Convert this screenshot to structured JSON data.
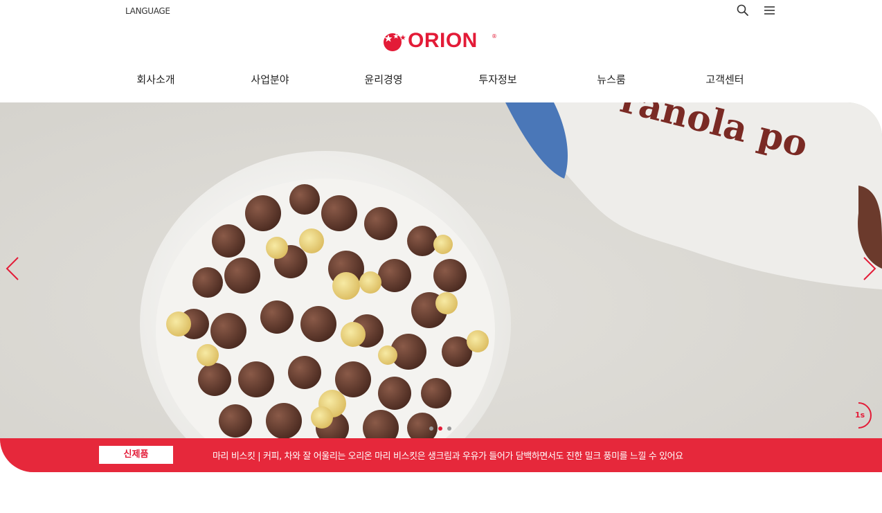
{
  "header": {
    "language_label": "LANGUAGE",
    "search_icon": "search-icon",
    "menu_icon": "hamburger-menu-icon",
    "logo_text": "ORION",
    "logo_registered": "®"
  },
  "nav": {
    "items": [
      {
        "label": "회사소개"
      },
      {
        "label": "사업분야"
      },
      {
        "label": "윤리경영"
      },
      {
        "label": "투자정보"
      },
      {
        "label": "뉴스룸"
      },
      {
        "label": "고객센터"
      }
    ]
  },
  "hero": {
    "package_text": "ranola po",
    "prev_icon": "chevron-left-icon",
    "next_icon": "chevron-right-icon",
    "slide_count": 3,
    "active_slide": 2,
    "timer_label": "1s"
  },
  "banner": {
    "badge": "신제품",
    "text": "마리 비스킷  |  커피, 차와 잘 어울리는 오리온 마리 비스킷은 생크림과 우유가 들어가 담백하면서도 진한 밀크 풍미를 느낄 수 있어요"
  },
  "colors": {
    "brand_red": "#e31b37",
    "banner_red": "#e6283b"
  }
}
